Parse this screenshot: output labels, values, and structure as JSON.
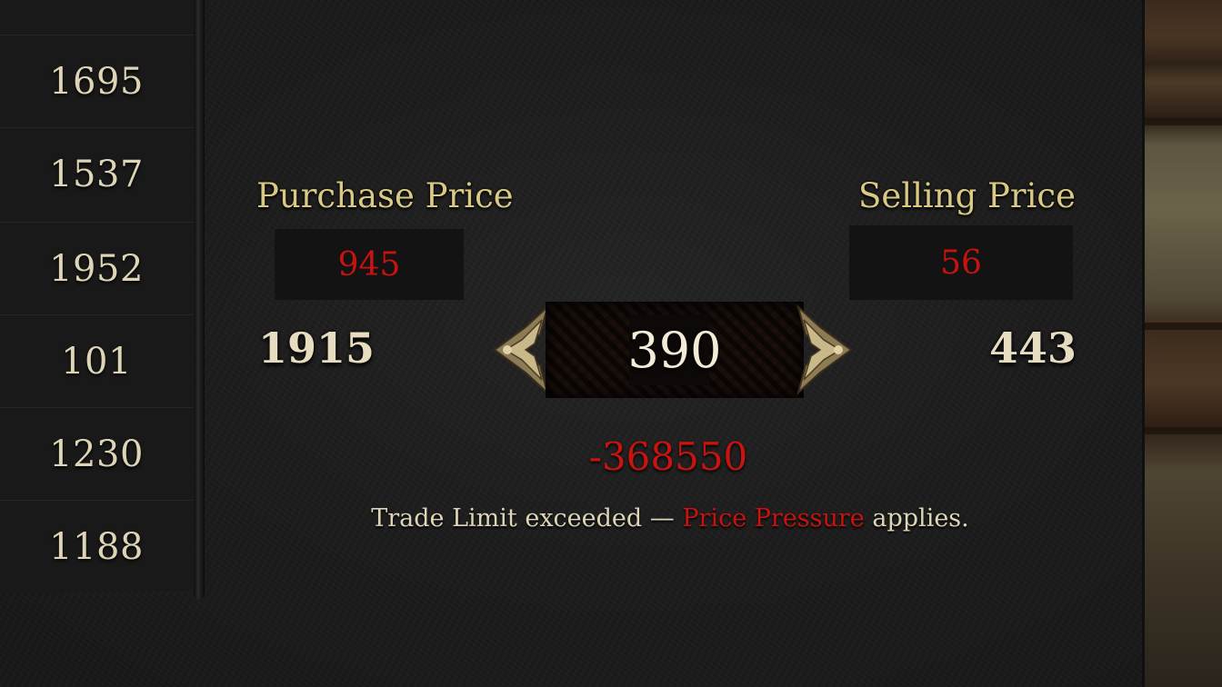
{
  "left_column": {
    "prices": [
      "1695",
      "1537",
      "1952",
      "101",
      "1230",
      "1188"
    ]
  },
  "purchase": {
    "label": "Purchase Price",
    "unit_price": "945",
    "stock": "1915"
  },
  "selling": {
    "label": "Selling Price",
    "unit_price": "56",
    "stock": "443"
  },
  "quantity": {
    "value": "390"
  },
  "total": "-368550",
  "notice": {
    "before": "Trade Limit exceeded —",
    "highlight": "Price Pressure",
    "after": "applies."
  },
  "colors": {
    "label_gold": "#d9c985",
    "warning_red": "#c8130f",
    "text_cream": "#ded4b6"
  }
}
